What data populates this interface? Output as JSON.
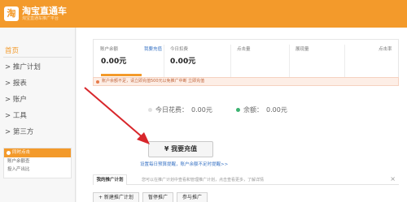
{
  "header": {
    "logo_mark": "淘",
    "logo_text": "淘宝直通车",
    "logo_sub": "淘宝直通车推广平台"
  },
  "sidebar": {
    "items": [
      {
        "label": "首页",
        "active": true
      },
      {
        "label": "> 推广计划"
      },
      {
        "label": "> 报表"
      },
      {
        "label": "> 账户"
      },
      {
        "label": "> 工具"
      },
      {
        "label": "> 第三方"
      }
    ],
    "panel": {
      "title": "同时点击",
      "lines": [
        "账户余额查",
        "投入产出比"
      ]
    }
  },
  "overview": {
    "balance_label": "账户余额",
    "recharge_link": "我要充值",
    "balance_value": "0.00元",
    "spend_label": "今日扣费",
    "spend_value": "0.00元",
    "clicks_label": "点击量",
    "impressions_label": "展现量",
    "ctr_label": "点击率"
  },
  "notice": "账户余额不足，请立即充值500元以免推广中断  立即充值",
  "today": {
    "label": "今日花费：",
    "value": "0.00元"
  },
  "balance": {
    "label": "余额：",
    "value": "0.00元"
  },
  "recharge_button": "¥ 我要充值",
  "set_link": "设置每日预算提醒，账户余额不足时提醒>>",
  "tabs": {
    "active": "我的推广计划",
    "hint": "您可以在推广计划中查看和管理推广计划，点击查看更多，了解详情",
    "close": "×"
  },
  "buttons": [
    "+ 新建推广计划",
    "暂停推广",
    "参与推广"
  ]
}
